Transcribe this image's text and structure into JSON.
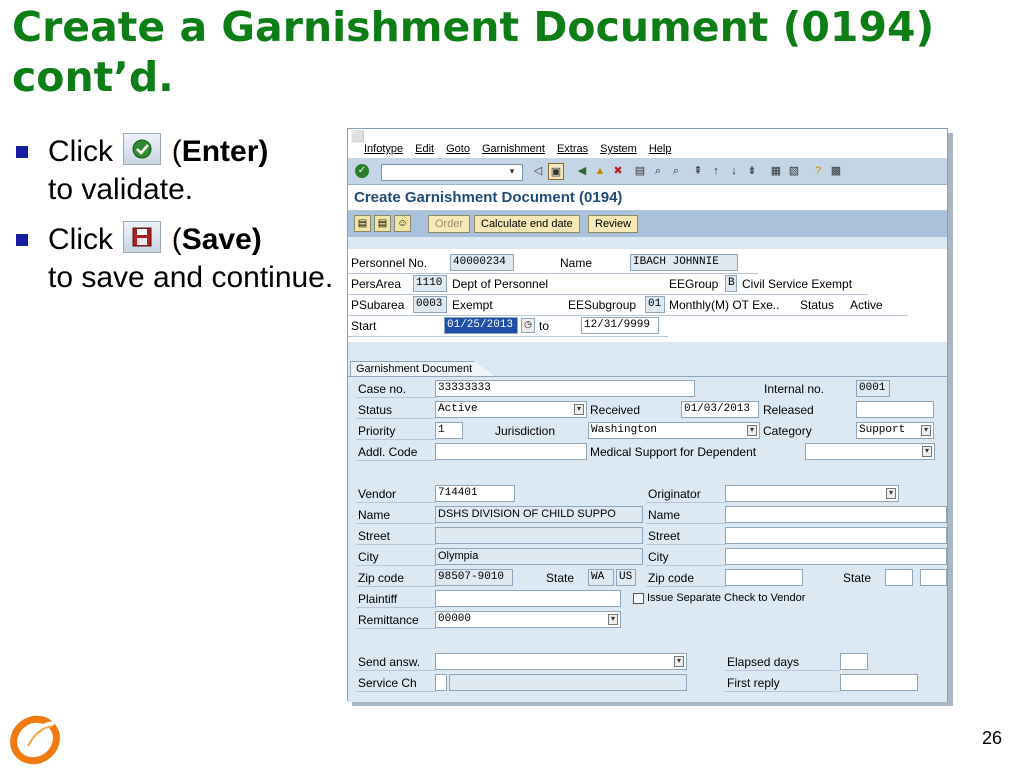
{
  "slide": {
    "title": "Create a Garnishment Document (0194) cont’d.",
    "page_number": "26",
    "bullets": [
      {
        "before": "Click ",
        "paren_open": "(",
        "bold": "Enter)",
        "after": "to validate."
      },
      {
        "before": "Click ",
        "paren_open": "(",
        "bold": "Save)",
        "after": "to save and continue."
      }
    ]
  },
  "sap": {
    "menu": [
      "Infotype",
      "Edit",
      "Goto",
      "Garnishment",
      "Extras",
      "System",
      "Help"
    ],
    "title": "Create Garnishment Document (0194)",
    "apptb": {
      "order": "Order",
      "calc": "Calculate end date",
      "review": "Review"
    },
    "header": {
      "personnel_no_label": "Personnel No.",
      "personnel_no": "40000234",
      "name_label": "Name",
      "name": "IBACH JOHNNIE",
      "persarea_label": "PersArea",
      "persarea_code": "1110",
      "persarea_text": "Dept of Personnel",
      "eegroup_label": "EEGroup",
      "eegroup_code": "B",
      "eegroup_text": "Civil Service Exempt",
      "psubarea_label": "PSubarea",
      "psubarea_code": "0003",
      "psubarea_text": "Exempt",
      "eesubgroup_label": "EESubgroup",
      "eesubgroup_code": "01",
      "eesubgroup_text": "Monthly(M) OT Exe..",
      "status_label": "Status",
      "status": "Active",
      "start_label": "Start",
      "start": "01/25/2013",
      "to_label": "to",
      "end": "12/31/9999"
    },
    "tab": {
      "label": "Garnishment Document",
      "case_no_label": "Case no.",
      "case_no": "33333333",
      "internal_no_label": "Internal no.",
      "internal_no": "0001",
      "status_label": "Status",
      "status": "Active",
      "received_label": "Received",
      "received": "01/03/2013",
      "released_label": "Released",
      "released": "",
      "priority_label": "Priority",
      "priority": "1",
      "jurisdiction_label": "Jurisdiction",
      "jurisdiction": "Washington",
      "category_label": "Category",
      "category": "Support",
      "addl_code_label": "Addl. Code",
      "addl_code": "",
      "medical_label": "Medical Support for Dependent",
      "vendor_label": "Vendor",
      "vendor": "714401",
      "originator_label": "Originator",
      "originator": "",
      "name_label": "Name",
      "vendor_name": "DSHS DIVISION OF CHILD SUPPO",
      "orig_name_label": "Name",
      "orig_name": "",
      "street_label": "Street",
      "vendor_street": "",
      "orig_street_label": "Street",
      "orig_street": "",
      "city_label": "City",
      "vendor_city": "Olympia",
      "orig_city_label": "City",
      "orig_city": "",
      "zip_label": "Zip code",
      "vendor_zip": "98507-9010",
      "state_label": "State",
      "vendor_state": "WA",
      "vendor_country": "US",
      "orig_zip_label": "Zip code",
      "orig_zip": "",
      "orig_state_label": "State",
      "orig_state": "",
      "orig_country": "",
      "plaintiff_label": "Plaintiff",
      "plaintiff": "",
      "separate_check_label": "Issue Separate Check to Vendor",
      "remittance_label": "Remittance",
      "remittance": "00000",
      "send_answ_label": "Send answ.",
      "send_answ": "",
      "elapsed_days_label": "Elapsed days",
      "elapsed_days": "",
      "service_ch_label": "Service Ch",
      "service_ch": "",
      "first_reply_label": "First reply",
      "first_reply": ""
    }
  },
  "colors": {
    "title_green": "#0d7d16",
    "sap_blue": "#1f4d7a",
    "bullet": "#1a1aa8"
  }
}
